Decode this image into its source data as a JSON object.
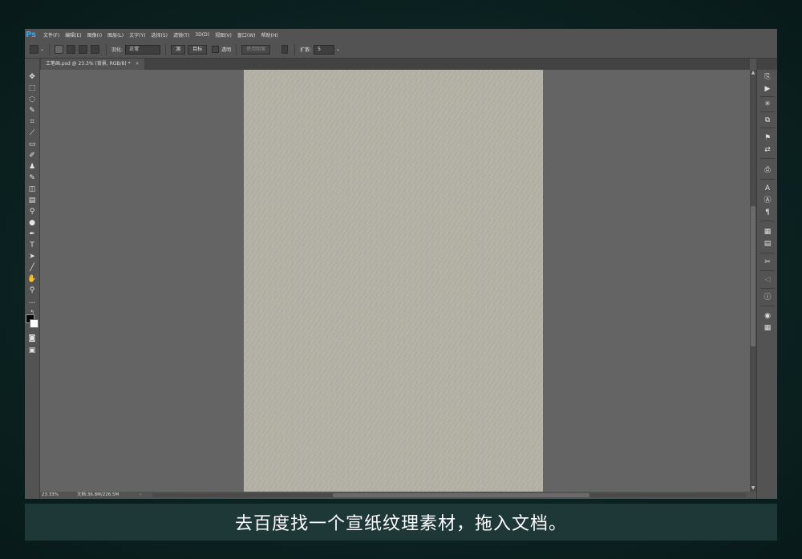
{
  "app": {
    "logo": "Ps",
    "accent": "#31a8ff"
  },
  "menu": [
    "文件(F)",
    "编辑(E)",
    "图像(I)",
    "图层(L)",
    "文字(Y)",
    "选择(S)",
    "滤镜(T)",
    "3D(D)",
    "视图(V)",
    "窗口(W)",
    "帮助(H)"
  ],
  "options": {
    "feather_label": "羽化:",
    "style_value": "正常",
    "source_label": "源",
    "dest_label": "目标",
    "transparent_label": "透明",
    "use_pattern_label": "使用图案",
    "diffusion_label": "扩散:",
    "diffusion_value": "5"
  },
  "document_tab": {
    "title": "工笔画.psd @ 23.3% (背景, RGB/8) *",
    "close": "×"
  },
  "status": {
    "zoom": "23.33%",
    "doc_info": "文档:36.8M/226.5M",
    "arrow": "›"
  },
  "paper_color": "#b3b1a4",
  "caption": "去百度找一个宣纸纹理素材，拖入文档。"
}
